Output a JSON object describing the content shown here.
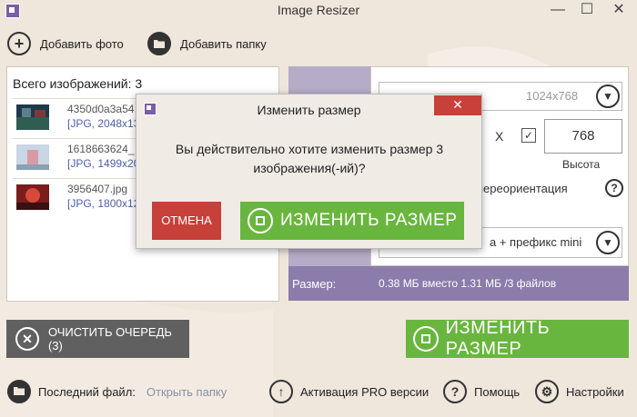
{
  "window": {
    "title": "Image Resizer",
    "minimize": "—",
    "maximize": "☐",
    "close": "✕"
  },
  "toolbar": {
    "add_photo": "Добавить фото",
    "add_folder": "Добавить папку"
  },
  "queue": {
    "total_label": "Всего изображений: 3",
    "files": [
      {
        "name": "4350d0a3a54",
        "info": "[JPG, 2048x13"
      },
      {
        "name": "1618663624_",
        "info": "[JPG, 1499x20"
      },
      {
        "name": "3956407.jpg",
        "info": "[JPG, 1800x12"
      }
    ]
  },
  "settings": {
    "preset_value": "1024x768",
    "x_label": "X",
    "checkbox_mark": "✓",
    "height_value": "768",
    "height_label": "Высота",
    "orientation_label": "переориентация",
    "help_mark": "?",
    "name_value": "а + префикс mini",
    "size_label": "Размер:",
    "size_value": "0.38 МБ вместо 1.31 МБ /3 файлов"
  },
  "actions": {
    "clear_queue": "ОЧИСТИТЬ ОЧЕРЕДЬ (3)",
    "resize": "ИЗМЕНИТЬ РАЗМЕР"
  },
  "statusbar": {
    "last_file_label": "Последний файл:",
    "open_folder": "Открыть папку",
    "pro_activation": "Активация PRO версии",
    "help": "Помощь",
    "settings": "Настройки"
  },
  "dialog": {
    "title": "Изменить размер",
    "message": "Вы действительно хотите изменить размер 3 изображения(-ий)?",
    "cancel": "ОТМЕНА",
    "confirm": "ИЗМЕНИТЬ РАЗМЕР"
  },
  "colors": {
    "background": "#efe6dc",
    "accent_green": "#69b63e",
    "accent_red": "#c7403a",
    "accent_purple": "#8b7cab",
    "dark_button": "#606060"
  }
}
